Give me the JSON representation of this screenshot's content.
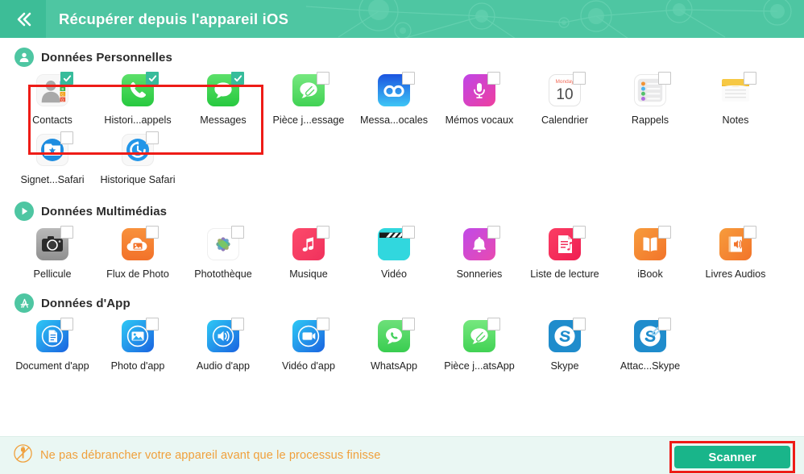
{
  "header": {
    "back_icon": "double-chevron-left-icon",
    "title": "Récupérer depuis l'appareil iOS",
    "bg_color": "#4ec6a2",
    "back_bg_color": "#3dbd97"
  },
  "sections": [
    {
      "id": "personal",
      "icon": "person-circle-icon",
      "title": "Données Personnelles",
      "items": [
        {
          "label": "Contacts",
          "icon": "contacts-icon",
          "checked": true
        },
        {
          "label": "Histori...appels",
          "icon": "phone-icon",
          "checked": true
        },
        {
          "label": "Messages",
          "icon": "messages-icon",
          "checked": true
        },
        {
          "label": "Pièce j...essage",
          "icon": "message-attachment-icon",
          "checked": false
        },
        {
          "label": "Messa...ocales",
          "icon": "voicemail-icon",
          "checked": false
        },
        {
          "label": "Mémos vocaux",
          "icon": "microphone-icon",
          "checked": false
        },
        {
          "label": "Calendrier",
          "icon": "calendar-icon",
          "checked": false
        },
        {
          "label": "Rappels",
          "icon": "reminders-icon",
          "checked": false
        },
        {
          "label": "Notes",
          "icon": "notes-icon",
          "checked": false
        },
        {
          "label": "Signet...Safari",
          "icon": "safari-bookmark-icon",
          "checked": false
        },
        {
          "label": "Historique Safari",
          "icon": "safari-history-icon",
          "checked": false
        }
      ]
    },
    {
      "id": "media",
      "icon": "play-circle-icon",
      "title": "Données Multimédias",
      "items": [
        {
          "label": "Pellicule",
          "icon": "camera-icon",
          "checked": false
        },
        {
          "label": "Flux de Photo",
          "icon": "photo-stream-icon",
          "checked": false
        },
        {
          "label": "Photothèque",
          "icon": "photos-icon",
          "checked": false
        },
        {
          "label": "Musique",
          "icon": "music-icon",
          "checked": false
        },
        {
          "label": "Vidéo",
          "icon": "video-icon",
          "checked": false
        },
        {
          "label": "Sonneries",
          "icon": "bell-icon",
          "checked": false
        },
        {
          "label": "Liste de lecture",
          "icon": "playlist-icon",
          "checked": false
        },
        {
          "label": "iBook",
          "icon": "ibook-icon",
          "checked": false
        },
        {
          "label": "Livres Audios",
          "icon": "audiobook-icon",
          "checked": false
        }
      ]
    },
    {
      "id": "app",
      "icon": "appstore-circle-icon",
      "title": "Données d'App",
      "items": [
        {
          "label": "Document d'app",
          "icon": "app-document-icon",
          "checked": false
        },
        {
          "label": "Photo d'app",
          "icon": "app-photo-icon",
          "checked": false
        },
        {
          "label": "Audio d'app",
          "icon": "app-audio-icon",
          "checked": false
        },
        {
          "label": "Vidéo d'app",
          "icon": "app-video-icon",
          "checked": false
        },
        {
          "label": "WhatsApp",
          "icon": "whatsapp-icon",
          "checked": false
        },
        {
          "label": "Pièce j...atsApp",
          "icon": "whatsapp-attachment-icon",
          "checked": false
        },
        {
          "label": "Skype",
          "icon": "skype-icon",
          "checked": false
        },
        {
          "label": "Attac...Skype",
          "icon": "skype-attachment-icon",
          "checked": false
        }
      ]
    }
  ],
  "footer": {
    "warn_icon": "no-unplug-icon",
    "warning": "Ne pas débrancher votre appareil avant que le processus finisse",
    "scan_label": "Scanner",
    "scan_color": "#19b58a",
    "warn_color": "#f0a03c",
    "highlight_color": "#ee1c17"
  }
}
